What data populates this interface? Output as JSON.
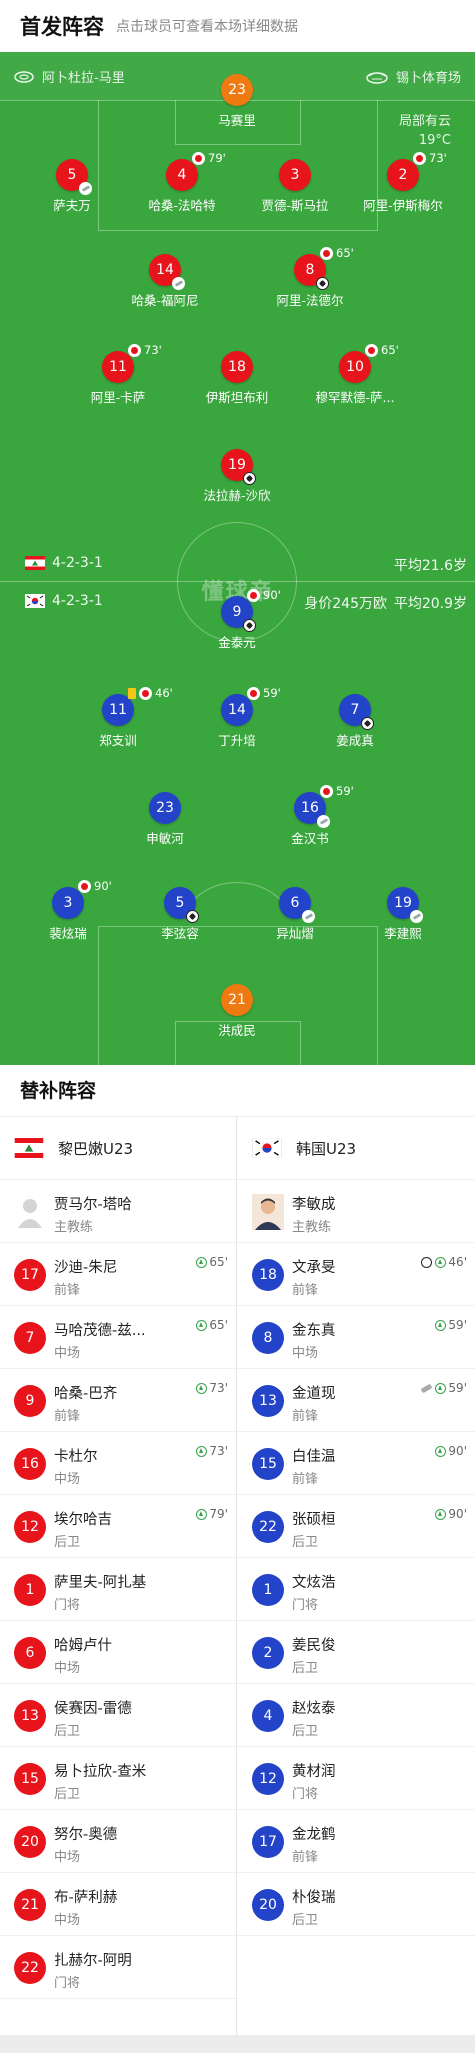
{
  "header": {
    "title": "首发阵容",
    "hint": "点击球员可查看本场详细数据"
  },
  "pitch": {
    "stadium_left": "阿卜杜拉-马里",
    "stadium_right": "锡卜体育场",
    "weather": "局部有云",
    "temperature": "19°C",
    "watermark": "懂球帝",
    "home": {
      "formation": "4-2-3-1",
      "avg_age": "平均21.6岁",
      "value": ""
    },
    "away": {
      "formation": "4-2-3-1",
      "avg_age": "平均20.9岁",
      "value": "身价245万欧"
    }
  },
  "home_players": [
    {
      "num": "23",
      "name": "马赛里",
      "color": "orange"
    },
    {
      "num": "5",
      "name": "萨夫万",
      "color": "red",
      "badge": "boot"
    },
    {
      "num": "4",
      "name": "哈桑-法哈特",
      "color": "red",
      "sub": "79'"
    },
    {
      "num": "3",
      "name": "贾德-斯马拉",
      "color": "red"
    },
    {
      "num": "2",
      "name": "阿里-伊斯梅尔",
      "color": "red",
      "sub": "73'"
    },
    {
      "num": "14",
      "name": "哈桑-福阿尼",
      "color": "red",
      "badge": "boot"
    },
    {
      "num": "8",
      "name": "阿里-法德尔",
      "color": "red",
      "sub": "65'",
      "badge": "ball"
    },
    {
      "num": "11",
      "name": "阿里-卡萨",
      "color": "red",
      "sub": "73'"
    },
    {
      "num": "18",
      "name": "伊斯坦布利",
      "color": "red"
    },
    {
      "num": "10",
      "name": "穆罕默德-萨...",
      "color": "red",
      "sub": "65'"
    },
    {
      "num": "19",
      "name": "法拉赫-沙欣",
      "color": "red",
      "badge": "ball"
    }
  ],
  "away_players": [
    {
      "num": "9",
      "name": "金泰元",
      "color": "blue",
      "sub": "90'",
      "badge": "ball"
    },
    {
      "num": "11",
      "name": "郑支训",
      "color": "blue",
      "sub": "46'",
      "yellow": true
    },
    {
      "num": "14",
      "name": "丁升培",
      "color": "blue",
      "sub": "59'"
    },
    {
      "num": "7",
      "name": "姜成真",
      "color": "blue",
      "badge": "ball"
    },
    {
      "num": "23",
      "name": "申敏河",
      "color": "blue"
    },
    {
      "num": "16",
      "name": "金汉书",
      "color": "blue",
      "sub": "59'",
      "badge": "boot"
    },
    {
      "num": "3",
      "name": "裴炫瑞",
      "color": "blue",
      "sub": "90'"
    },
    {
      "num": "5",
      "name": "李弦容",
      "color": "blue",
      "badge": "ball"
    },
    {
      "num": "6",
      "name": "异灿熠",
      "color": "blue",
      "badge": "boot"
    },
    {
      "num": "19",
      "name": "李建熙",
      "color": "blue",
      "badge": "boot"
    },
    {
      "num": "21",
      "name": "洪成民",
      "color": "orange"
    }
  ],
  "subs": {
    "title": "替补阵容",
    "home": {
      "team": "黎巴嫩U23",
      "coach": {
        "name": "贾马尔-塔哈",
        "role": "主教练"
      },
      "players": [
        {
          "num": "17",
          "name": "沙迪-朱尼",
          "pos": "前锋",
          "ev": "65'"
        },
        {
          "num": "7",
          "name": "马哈茂德-兹...",
          "pos": "中场",
          "ev": "65'"
        },
        {
          "num": "9",
          "name": "哈桑-巴齐",
          "pos": "前锋",
          "ev": "73'"
        },
        {
          "num": "16",
          "name": "卡杜尔",
          "pos": "中场",
          "ev": "73'"
        },
        {
          "num": "12",
          "name": "埃尔哈吉",
          "pos": "后卫",
          "ev": "79'"
        },
        {
          "num": "1",
          "name": "萨里夫-阿扎基",
          "pos": "门将",
          "ev": ""
        },
        {
          "num": "6",
          "name": "哈姆卢什",
          "pos": "中场",
          "ev": ""
        },
        {
          "num": "13",
          "name": "侯赛因-雷德",
          "pos": "后卫",
          "ev": ""
        },
        {
          "num": "15",
          "name": "易卜拉欣-查米",
          "pos": "后卫",
          "ev": ""
        },
        {
          "num": "20",
          "name": "努尔-奥德",
          "pos": "中场",
          "ev": ""
        },
        {
          "num": "21",
          "name": "布-萨利赫",
          "pos": "中场",
          "ev": ""
        },
        {
          "num": "22",
          "name": "扎赫尔-阿明",
          "pos": "门将",
          "ev": ""
        }
      ]
    },
    "away": {
      "team": "韩国U23",
      "coach": {
        "name": "李敏成",
        "role": "主教练"
      },
      "players": [
        {
          "num": "18",
          "name": "文承旻",
          "pos": "前锋",
          "ev": "46'",
          "pre": "ball"
        },
        {
          "num": "8",
          "name": "金东真",
          "pos": "中场",
          "ev": "59'"
        },
        {
          "num": "13",
          "name": "金道现",
          "pos": "前锋",
          "ev": "59'",
          "pre": "boot"
        },
        {
          "num": "15",
          "name": "白佳温",
          "pos": "前锋",
          "ev": "90'"
        },
        {
          "num": "22",
          "name": "张硕桓",
          "pos": "后卫",
          "ev": "90'"
        },
        {
          "num": "1",
          "name": "文炫浩",
          "pos": "门将",
          "ev": ""
        },
        {
          "num": "2",
          "name": "姜民俊",
          "pos": "后卫",
          "ev": ""
        },
        {
          "num": "4",
          "name": "赵炫泰",
          "pos": "后卫",
          "ev": ""
        },
        {
          "num": "12",
          "name": "黄材润",
          "pos": "门将",
          "ev": ""
        },
        {
          "num": "17",
          "name": "金龙鹤",
          "pos": "前锋",
          "ev": ""
        },
        {
          "num": "20",
          "name": "朴俊瑞",
          "pos": "后卫",
          "ev": ""
        }
      ]
    }
  },
  "colors": {
    "pitch": "#3aa63e",
    "home": "#e8141b",
    "away": "#2343c8",
    "keeper": "#f07a12"
  }
}
